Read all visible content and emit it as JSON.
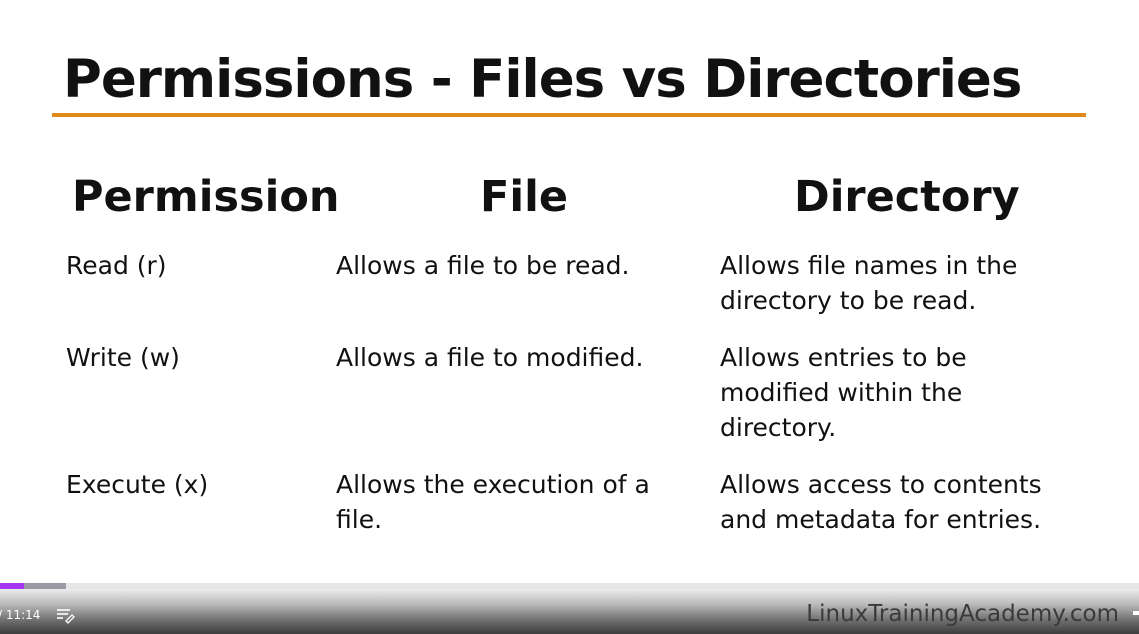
{
  "slide": {
    "title": "Permissions - Files vs Directories",
    "accent_color": "#e08a1e",
    "headers": {
      "permission": "Permission",
      "file": "File",
      "directory": "Directory"
    },
    "rows": [
      {
        "permission": "Read (r)",
        "file": "Allows a file to be read.",
        "directory": "Allows file names in the directory to be read."
      },
      {
        "permission": "Write (w)",
        "file": "Allows a file to modified.",
        "directory": "Allows entries to be modified within the directory."
      },
      {
        "permission": "Execute (x)",
        "file": "Allows the execution of a file.",
        "directory": "Allows access to contents and metadata for entries."
      }
    ]
  },
  "player": {
    "time_display": "/ 11:14",
    "progress_fraction": 0.021,
    "buffered_fraction": 0.058,
    "progress_color": "#a435f0",
    "transcript_icon": "transcript-icon",
    "watermark": "LinuxTrainingAcademy.com"
  }
}
